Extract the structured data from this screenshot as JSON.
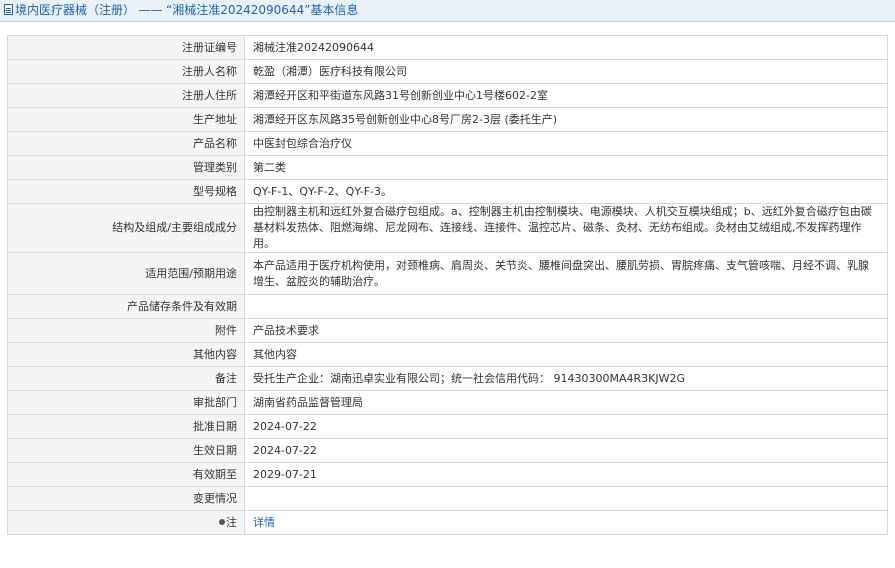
{
  "header": {
    "crumb": "境内医疗器械（注册）",
    "separator": "——",
    "title": "“湘械注准20242090644”基本信息",
    "icon": "document-icon"
  },
  "rows": [
    {
      "label": "注册证编号",
      "value": "湘械注准20242090644"
    },
    {
      "label": "注册人名称",
      "value": "乾盈（湘潭）医疗科技有限公司"
    },
    {
      "label": "注册人住所",
      "value": "湘潭经开区和平街道东风路31号创新创业中心1号楼602-2室"
    },
    {
      "label": "生产地址",
      "value": "湘潭经开区东风路35号创新创业中心8号厂房2-3层 (委托生产)"
    },
    {
      "label": "产品名称",
      "value": "中医封包综合治疗仪"
    },
    {
      "label": "管理类别",
      "value": "第二类"
    },
    {
      "label": "型号规格",
      "value": "QY-F-1、QY-F-2、QY-F-3。"
    },
    {
      "label": "结构及组成/主要组成成分",
      "value": "由控制器主机和远红外复合磁疗包组成。a、控制器主机由控制模块、电源模块、人机交互模块组成；b、远红外复合磁疗包由碳基材料发热体、阻燃海绵、尼龙网布、连接线、连接件、温控芯片、磁条、灸材、无纺布组成。灸材由艾绒组成,不发挥药理作用。"
    },
    {
      "label": "适用范围/预期用途",
      "value": "本产品适用于医疗机构使用，对颈椎病、肩周炎、关节炎、腰椎间盘突出、腰肌劳损、胃脘疼痛、支气管咳喘、月经不调、乳腺增生、盆腔炎的辅助治疗。"
    },
    {
      "label": "产品储存条件及有效期",
      "value": ""
    },
    {
      "label": "附件",
      "value": "产品技术要求"
    },
    {
      "label": "其他内容",
      "value": "其他内容"
    },
    {
      "label": "备注",
      "value": "受托生产企业：湖南迅卓实业有限公司；统一社会信用代码： 91430300MA4R3KJW2G"
    },
    {
      "label": "审批部门",
      "value": "湖南省药品监督管理局"
    },
    {
      "label": "批准日期",
      "value": "2024-07-22"
    },
    {
      "label": "生效日期",
      "value": "2024-07-22"
    },
    {
      "label": "有效期至",
      "value": "2029-07-21"
    },
    {
      "label": "变更情况",
      "value": ""
    }
  ],
  "note": {
    "label": "注",
    "link": "详情",
    "icon": "pin-icon"
  }
}
